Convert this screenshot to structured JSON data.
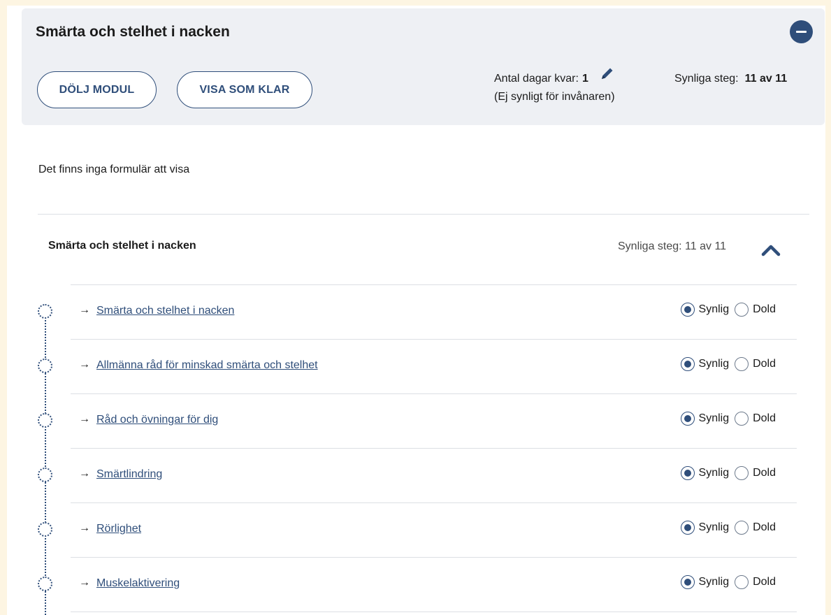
{
  "module": {
    "title": "Smärta och stelhet i nacken",
    "hide_button": "DÖLJ MODUL",
    "done_button": "VISA SOM KLAR",
    "days_label": "Antal dagar kvar:",
    "days_value": "1",
    "days_note": "(Ej synligt för invånaren)",
    "visible_label": "Synliga steg:",
    "visible_value": "11 av 11"
  },
  "forms": {
    "empty_text": "Det finns inga formulär att visa"
  },
  "section": {
    "title": "Smärta och stelhet i nacken",
    "visible_steps": "Synliga steg: 11 av 11"
  },
  "steps": [
    {
      "label": "Smärta och stelhet i nacken",
      "arrow": "→",
      "visible": "Synlig",
      "hidden": "Dold"
    },
    {
      "label": "Allmänna råd för minskad smärta och stelhet",
      "arrow": "→",
      "visible": "Synlig",
      "hidden": "Dold"
    },
    {
      "label": "Råd och övningar för dig",
      "arrow": "→",
      "visible": "Synlig",
      "hidden": "Dold"
    },
    {
      "label": "Smärtlindring",
      "arrow": "→",
      "visible": "Synlig",
      "hidden": "Dold"
    },
    {
      "label": "Rörlighet",
      "arrow": "→",
      "visible": "Synlig",
      "hidden": "Dold"
    },
    {
      "label": "Muskelaktivering",
      "arrow": "→",
      "visible": "Synlig",
      "hidden": "Dold"
    }
  ],
  "colors": {
    "accent": "#2f4e7a",
    "header_bg": "#eef0f4",
    "frame": "#fdf5e2"
  },
  "icons": {
    "collapse": "minus-circle-icon",
    "edit": "pencil-icon",
    "section_toggle": "chevron-up-icon"
  }
}
